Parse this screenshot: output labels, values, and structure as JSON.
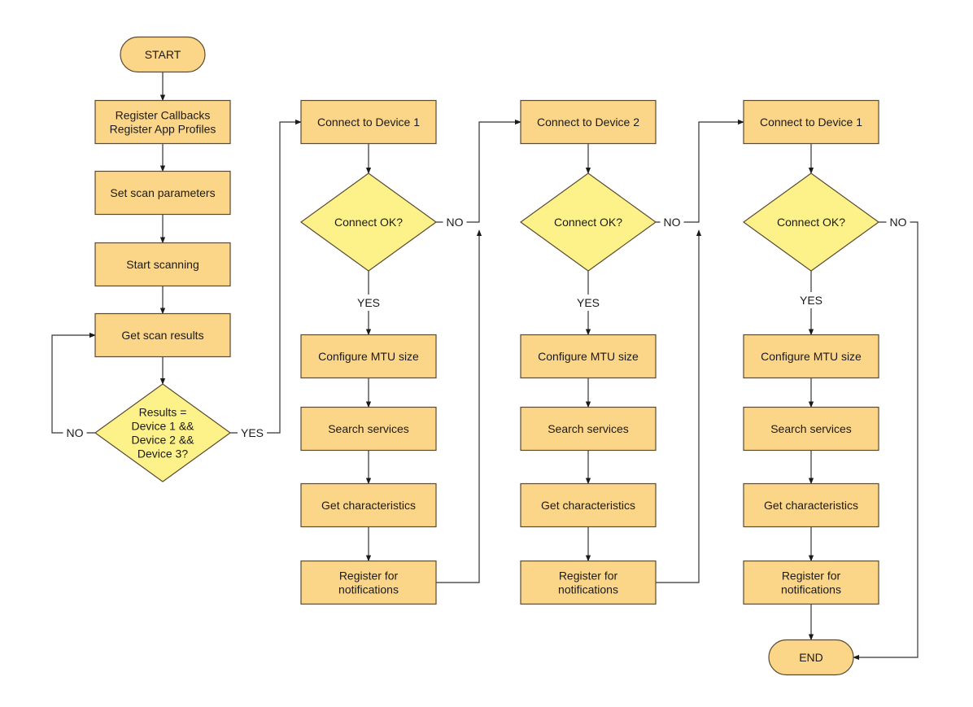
{
  "diagram": {
    "type": "flowchart",
    "colors": {
      "process_fill": "#fcd688",
      "decision_fill": "#fdf189",
      "terminal_fill": "#fcd688",
      "stroke": "#5a4a33",
      "edge": "#333333"
    },
    "nodes": {
      "start": {
        "kind": "terminal",
        "lines": [
          "START"
        ]
      },
      "register_callbacks": {
        "kind": "process",
        "lines": [
          "Register Callbacks",
          "Register App Profiles"
        ]
      },
      "set_scan_params": {
        "kind": "process",
        "lines": [
          "Set scan parameters"
        ]
      },
      "start_scanning": {
        "kind": "process",
        "lines": [
          "Start scanning"
        ]
      },
      "get_scan_results": {
        "kind": "process",
        "lines": [
          "Get scan results"
        ]
      },
      "results_check": {
        "kind": "decision",
        "lines": [
          "Results =",
          "Device 1 &&",
          "Device 2 &&",
          "Device 3?"
        ]
      },
      "c1_connect": {
        "kind": "process",
        "lines": [
          "Connect to Device 1"
        ]
      },
      "c1_ok": {
        "kind": "decision",
        "lines": [
          "Connect OK?"
        ]
      },
      "c1_mtu": {
        "kind": "process",
        "lines": [
          "Configure MTU size"
        ]
      },
      "c1_search": {
        "kind": "process",
        "lines": [
          "Search services"
        ]
      },
      "c1_chars": {
        "kind": "process",
        "lines": [
          "Get characteristics"
        ]
      },
      "c1_notify": {
        "kind": "process",
        "lines": [
          "Register for",
          "notifications"
        ]
      },
      "c2_connect": {
        "kind": "process",
        "lines": [
          "Connect to Device 2"
        ]
      },
      "c2_ok": {
        "kind": "decision",
        "lines": [
          "Connect OK?"
        ]
      },
      "c2_mtu": {
        "kind": "process",
        "lines": [
          "Configure MTU size"
        ]
      },
      "c2_search": {
        "kind": "process",
        "lines": [
          "Search services"
        ]
      },
      "c2_chars": {
        "kind": "process",
        "lines": [
          "Get characteristics"
        ]
      },
      "c2_notify": {
        "kind": "process",
        "lines": [
          "Register for",
          "notifications"
        ]
      },
      "c3_connect": {
        "kind": "process",
        "lines": [
          "Connect to Device 1"
        ]
      },
      "c3_ok": {
        "kind": "decision",
        "lines": [
          "Connect OK?"
        ]
      },
      "c3_mtu": {
        "kind": "process",
        "lines": [
          "Configure MTU size"
        ]
      },
      "c3_search": {
        "kind": "process",
        "lines": [
          "Search services"
        ]
      },
      "c3_chars": {
        "kind": "process",
        "lines": [
          "Get characteristics"
        ]
      },
      "c3_notify": {
        "kind": "process",
        "lines": [
          "Register for",
          "notifications"
        ]
      },
      "end": {
        "kind": "terminal",
        "lines": [
          "END"
        ]
      }
    },
    "edge_labels": {
      "results_no": "NO",
      "results_yes": "YES",
      "c1_yes": "YES",
      "c1_no": "NO",
      "c2_yes": "YES",
      "c2_no": "NO",
      "c3_yes": "YES",
      "c3_no": "NO"
    },
    "edges": [
      {
        "from": "start",
        "to": "register_callbacks"
      },
      {
        "from": "register_callbacks",
        "to": "set_scan_params"
      },
      {
        "from": "set_scan_params",
        "to": "start_scanning"
      },
      {
        "from": "start_scanning",
        "to": "get_scan_results"
      },
      {
        "from": "get_scan_results",
        "to": "results_check"
      },
      {
        "from": "results_check",
        "to": "get_scan_results",
        "label": "NO"
      },
      {
        "from": "results_check",
        "to": "c1_connect",
        "label": "YES"
      },
      {
        "from": "c1_connect",
        "to": "c1_ok"
      },
      {
        "from": "c1_ok",
        "to": "c1_mtu",
        "label": "YES"
      },
      {
        "from": "c1_ok",
        "to": "c2_connect",
        "label": "NO"
      },
      {
        "from": "c1_mtu",
        "to": "c1_search"
      },
      {
        "from": "c1_search",
        "to": "c1_chars"
      },
      {
        "from": "c1_chars",
        "to": "c1_notify"
      },
      {
        "from": "c1_notify",
        "to": "c2_connect"
      },
      {
        "from": "c2_connect",
        "to": "c2_ok"
      },
      {
        "from": "c2_ok",
        "to": "c2_mtu",
        "label": "YES"
      },
      {
        "from": "c2_ok",
        "to": "c3_connect",
        "label": "NO"
      },
      {
        "from": "c2_mtu",
        "to": "c2_search"
      },
      {
        "from": "c2_search",
        "to": "c2_chars"
      },
      {
        "from": "c2_chars",
        "to": "c2_notify"
      },
      {
        "from": "c2_notify",
        "to": "c3_connect"
      },
      {
        "from": "c3_connect",
        "to": "c3_ok"
      },
      {
        "from": "c3_ok",
        "to": "c3_mtu",
        "label": "YES"
      },
      {
        "from": "c3_ok",
        "to": "end",
        "label": "NO"
      },
      {
        "from": "c3_mtu",
        "to": "c3_search"
      },
      {
        "from": "c3_search",
        "to": "c3_chars"
      },
      {
        "from": "c3_chars",
        "to": "c3_notify"
      },
      {
        "from": "c3_notify",
        "to": "end"
      }
    ]
  }
}
